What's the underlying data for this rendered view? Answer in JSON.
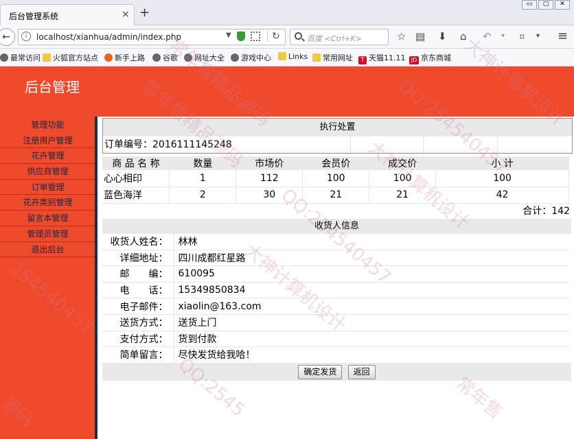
{
  "browser": {
    "tab_title": "后台管理系统",
    "tab_close": "×",
    "new_tab": "+",
    "window_buttons": [
      "▭",
      "▢",
      "✕"
    ],
    "url": "localhost/xianhua/admin/index.php",
    "search_placeholder": "百度 <Ctrl+K>",
    "bookmarks": [
      "最常访问",
      "火狐官方站点",
      "新手上路",
      "谷歌",
      "网址大全",
      "游戏中心",
      "Links",
      "常用网址",
      "天猫11.11",
      "京东商城"
    ]
  },
  "admin": {
    "title": "后台管理",
    "sidebar": [
      "管理功能",
      "注册用户管理",
      "花卉管理",
      "供应商管理",
      "订单管理",
      "花卉类别管理",
      "留言本管理",
      "管理员管理",
      "退出后台"
    ]
  },
  "order": {
    "section_title": "执行处置",
    "order_no_label": "订单编号：",
    "order_no": "2016111145248",
    "columns": [
      "商 品 名 称",
      "数量",
      "市场价",
      "会员价",
      "成交价",
      "小 计"
    ],
    "items": [
      {
        "name": "心心相印",
        "qty": "1",
        "market": "112",
        "member": "100",
        "deal": "100",
        "subtotal": "100"
      },
      {
        "name": "蓝色海洋",
        "qty": "2",
        "market": "30",
        "member": "21",
        "deal": "21",
        "subtotal": "42"
      }
    ],
    "total": "合计：142"
  },
  "receiver": {
    "section_title": "收货人信息",
    "rows": [
      {
        "label": "收货人姓名：",
        "value": "林林"
      },
      {
        "label": "详细地址：",
        "value": "四川成都红星路"
      },
      {
        "label": "邮　　编：",
        "value": "610095"
      },
      {
        "label": "电　　话：",
        "value": "15349850834"
      },
      {
        "label": "电子邮件：",
        "value": "xiaolin@163.com"
      },
      {
        "label": "送货方式：",
        "value": "送货上门"
      },
      {
        "label": "支付方式：",
        "value": "货到付款"
      },
      {
        "label": "简单留言：",
        "value": "尽快发货给我哈！"
      }
    ],
    "confirm_button": "确定发货",
    "back_button": "返回"
  },
  "watermarks": [
    "常年售精品源码",
    "大神计算机设计",
    "QQ:254540457",
    "常年售",
    "源码",
    "QQ:2545",
    "大神计算机设计",
    "QQ:254540457",
    "常年售精品源码",
    "254540457",
    "大神计算机设计"
  ]
}
